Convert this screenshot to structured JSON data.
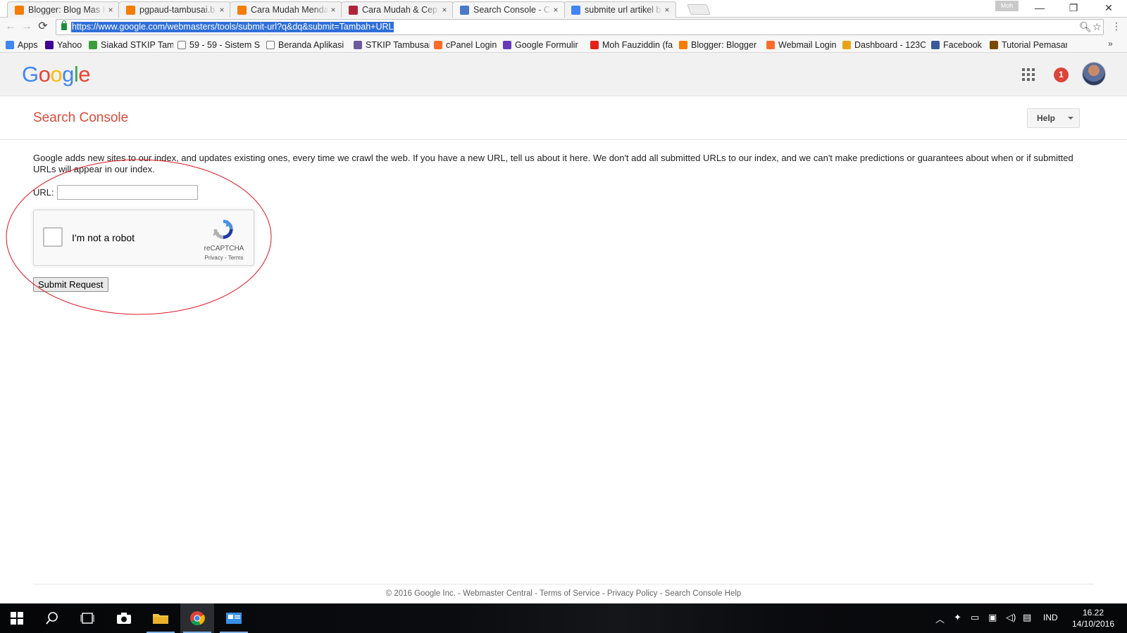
{
  "browser": {
    "tabs": [
      {
        "title": "Blogger: Blog Mas I",
        "favicon_color": "#f57d00"
      },
      {
        "title": "pgpaud-tambusai.b",
        "favicon_color": "#f57d00"
      },
      {
        "title": "Cara Mudah Menda",
        "favicon_color": "#f57d00"
      },
      {
        "title": "Cara Mudah & Cep",
        "favicon_color": "#b0243a"
      },
      {
        "title": "Search Console - Cr",
        "favicon_color": "#4a79c9"
      },
      {
        "title": "submite url artikel b",
        "favicon_color": "#4285f4"
      }
    ],
    "active_tab": 4,
    "close_glyph": "×",
    "profile_name": "Moh",
    "window_controls": {
      "minimize": "—",
      "restore": "❐",
      "close": "✕"
    },
    "url": "https://www.google.com/webmasters/tools/submit-url?q&dq&submit=Tambah+URL",
    "bookmarks": [
      {
        "label": "Apps",
        "icon_color": "#4285f4"
      },
      {
        "label": "Yahoo",
        "icon_color": "#410093"
      },
      {
        "label": "Siakad STKIP Tam",
        "icon_color": "#3c9d3c"
      },
      {
        "label": "59 - 59 - Sistem S",
        "icon_color": "#ffffff"
      },
      {
        "label": "Beranda Aplikasi",
        "icon_color": "#ffffff"
      },
      {
        "label": "STKIP Tambusai",
        "icon_color": "#6d5a9c"
      },
      {
        "label": "cPanel Login",
        "icon_color": "#ff6c2c"
      },
      {
        "label": "Google Formulir",
        "icon_color": "#673ab7"
      },
      {
        "label": "Moh Fauziddin (fa",
        "icon_color": "#e62117"
      },
      {
        "label": "Blogger: Blogger",
        "icon_color": "#f57d00"
      },
      {
        "label": "Webmail Login",
        "icon_color": "#ff6c2c"
      },
      {
        "label": "Dashboard - 123C",
        "icon_color": "#e8a317"
      },
      {
        "label": "Facebook",
        "icon_color": "#3b5998"
      },
      {
        "label": "Tutorial Pemasan",
        "icon_color": "#7a4a00"
      }
    ],
    "more": "»"
  },
  "google_header": {
    "logo_letters": [
      "G",
      "o",
      "o",
      "g",
      "l",
      "e"
    ],
    "logo_colors": [
      "#4285f4",
      "#ea4335",
      "#fbbc05",
      "#4285f4",
      "#34a853",
      "#ea4335"
    ],
    "notification_count": "1"
  },
  "console": {
    "title": "Search Console",
    "help_label": "Help",
    "description": "Google adds new sites to our index, and updates existing ones, every time we crawl the web. If you have a new URL, tell us about it here. We don't add all submitted URLs to our index, and we can't make predictions or guarantees about when or if submitted URLs will appear in our index.",
    "url_label": "URL:",
    "url_value": "",
    "recaptcha": {
      "label": "I'm not a robot",
      "brand": "reCAPTCHA",
      "links": "Privacy - Terms"
    },
    "submit_label": "Submit Request",
    "annotation_color": "#e0141e"
  },
  "footer": {
    "text": "© 2016 Google Inc. - Webmaster Central - Terms of Service - Privacy Policy - Search Console Help"
  },
  "taskbar": {
    "items": [
      "start-icon",
      "search-icon",
      "task-view-icon",
      "camera-icon",
      "file-explorer-icon",
      "chrome-icon",
      "app-icon"
    ],
    "language": "IND",
    "time": "16.22",
    "date": "14/10/2016"
  }
}
